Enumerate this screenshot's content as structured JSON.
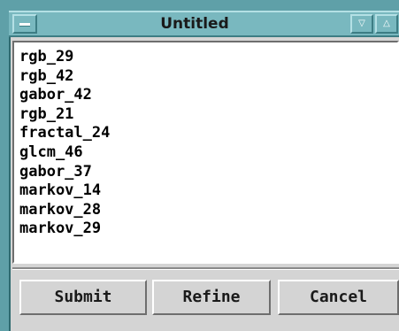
{
  "window": {
    "title": "Untitled",
    "minimize_glyph": "▽",
    "maximize_glyph": "△"
  },
  "list": {
    "items": [
      "rgb_29",
      "rgb_42",
      "gabor_42",
      "rgb_21",
      "fractal_24",
      "glcm_46",
      "gabor_37",
      "markov_14",
      "markov_28",
      "markov_29"
    ]
  },
  "buttons": {
    "submit": "Submit",
    "refine": "Refine",
    "cancel": "Cancel"
  },
  "colors": {
    "titlebar": "#79b8bf",
    "frame": "#5fa0a8",
    "panel": "#d4d4d4"
  }
}
